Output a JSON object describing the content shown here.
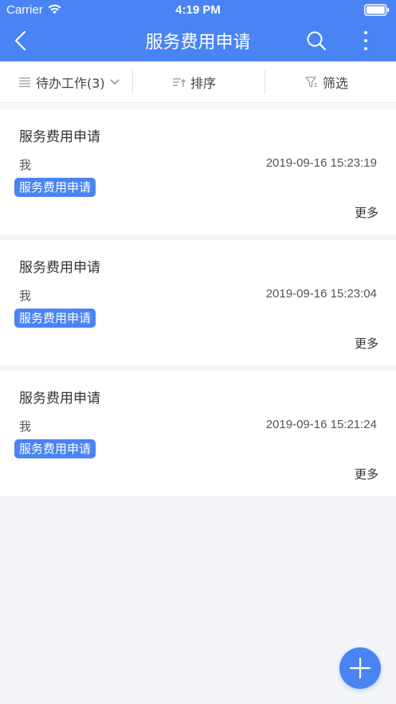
{
  "status_bar": {
    "carrier": "Carrier",
    "time": "4:19 PM"
  },
  "navbar": {
    "title": "服务费用申请",
    "back_icon": "chevron-left-icon",
    "search_icon": "search-icon",
    "more_icon": "more-vertical-icon"
  },
  "filters": {
    "pending": "待办工作(3)",
    "sort": "排序",
    "filter": "筛选"
  },
  "cards": [
    {
      "title": "服务费用申请",
      "user": "我",
      "date": "2019-09-16 15:23:19",
      "tag": "服务费用申请",
      "more": "更多"
    },
    {
      "title": "服务费用申请",
      "user": "我",
      "date": "2019-09-16 15:23:04",
      "tag": "服务费用申请",
      "more": "更多"
    },
    {
      "title": "服务费用申请",
      "user": "我",
      "date": "2019-09-16 15:21:24",
      "tag": "服务费用申请",
      "more": "更多"
    }
  ],
  "colors": {
    "primary": "#4a84f4",
    "background": "#f4f5f9"
  }
}
